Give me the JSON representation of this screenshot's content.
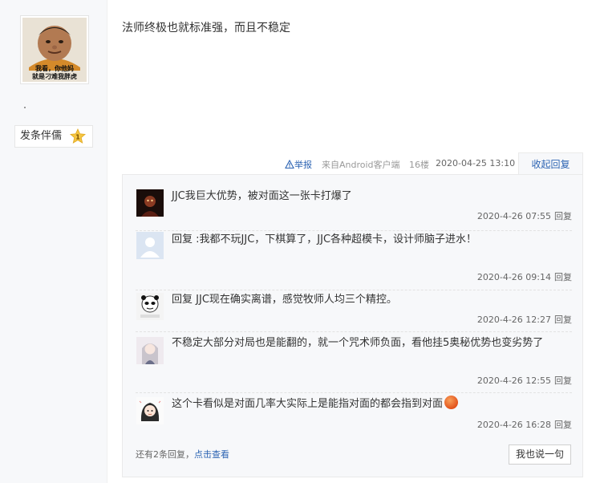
{
  "author": {
    "avatar_caption_line1": "我看，你他妈",
    "avatar_caption_line2": "就是刁难我胖虎",
    "send_button_label": "发条伴儒",
    "badge_level": "1"
  },
  "post": {
    "text": "法师终极也就标准强，而且不稳定",
    "report_label": "举报",
    "source": "来自Android客户端",
    "floor": "16楼",
    "time": "2020-04-25 13:10",
    "collapse_label": "收起回复"
  },
  "replies": [
    {
      "user": "        ",
      "reply_word": "",
      "target": "",
      "text": "JJC我巨大优势，被对面这一张卡打爆了",
      "time": "2020-4-26 07:55",
      "reply_label": "回复"
    },
    {
      "user": "                  ",
      "reply_word": "回复",
      "target": "         ",
      "text": ":我都不玩JJC，下棋算了，JJC各种超模卡，设计师脑子进水！",
      "time": "2020-4-26 09:14",
      "reply_label": "回复"
    },
    {
      "user": "       ",
      "reply_word": "回复",
      "target": "               ",
      "text": "JJC现在确实离谱，感觉牧师人均三个精控。",
      "time": "2020-4-26 12:27",
      "reply_label": "回复"
    },
    {
      "user": "                ",
      "reply_word": "",
      "target": "",
      "text": "不稳定大部分对局也是能翻的，就一个咒术师负面，看他挂5奥秘优势也变劣势了",
      "time": "2020-4-26 12:55",
      "reply_label": "回复"
    },
    {
      "user": "              ",
      "reply_word": "",
      "target": "",
      "text": "这个卡看似是对面几率大实际上是能指对面的都会指到对面",
      "time": "2020-4-26 16:28",
      "reply_label": "回复"
    }
  ],
  "more": {
    "prefix": "还有2条回复，",
    "link": "点击查看",
    "say_button": "我也说一句"
  },
  "colors": {
    "link_blue": "#2d64b3",
    "reply_bg": "#f7f8fa"
  }
}
